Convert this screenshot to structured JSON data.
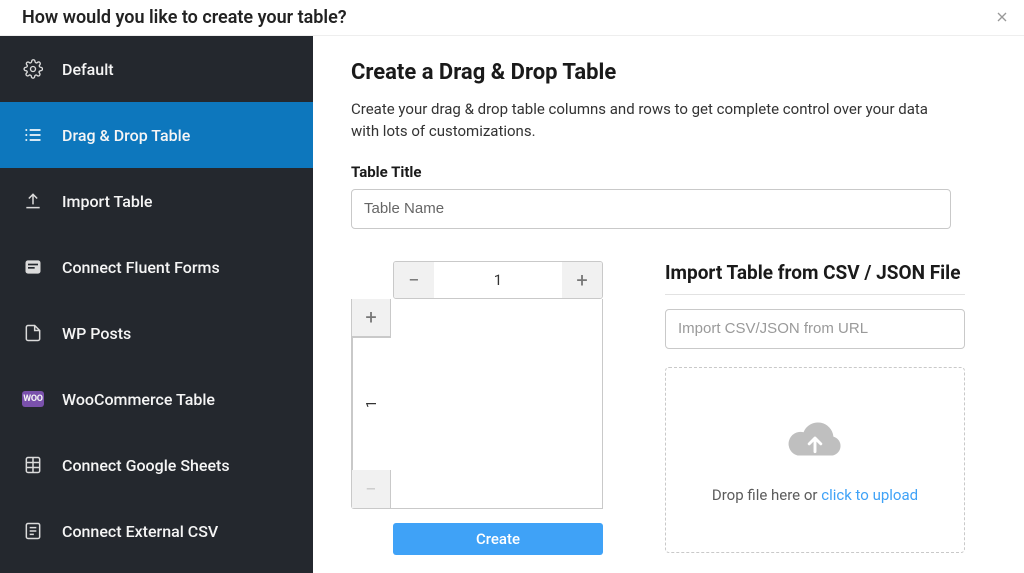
{
  "header": {
    "title": "How would you like to create your table?"
  },
  "sidebar": {
    "items": [
      {
        "key": "default",
        "label": "Default"
      },
      {
        "key": "drag-drop",
        "label": "Drag & Drop Table",
        "active": true
      },
      {
        "key": "import",
        "label": "Import Table"
      },
      {
        "key": "fluent-forms",
        "label": "Connect Fluent Forms"
      },
      {
        "key": "wp-posts",
        "label": "WP Posts"
      },
      {
        "key": "woocommerce",
        "label": "WooCommerce Table"
      },
      {
        "key": "google-sheets",
        "label": "Connect Google Sheets"
      },
      {
        "key": "external-csv",
        "label": "Connect External CSV"
      }
    ]
  },
  "main": {
    "title": "Create a Drag & Drop Table",
    "description": "Create your drag & drop table columns and rows to get complete control over your data with lots of customizations.",
    "table_title_label": "Table Title",
    "table_title_placeholder": "Table Name",
    "columns_value": "1",
    "rows_value": "1",
    "create_label": "Create"
  },
  "import": {
    "title": "Import Table from CSV / JSON File",
    "url_placeholder": "Import CSV/JSON from URL",
    "drop_text_prefix": "Drop file here or ",
    "drop_text_link": "click to upload"
  },
  "colors": {
    "accent": "#3fa2f7",
    "sidebar_active": "#0d77bd",
    "woo": "#7f54b3"
  }
}
